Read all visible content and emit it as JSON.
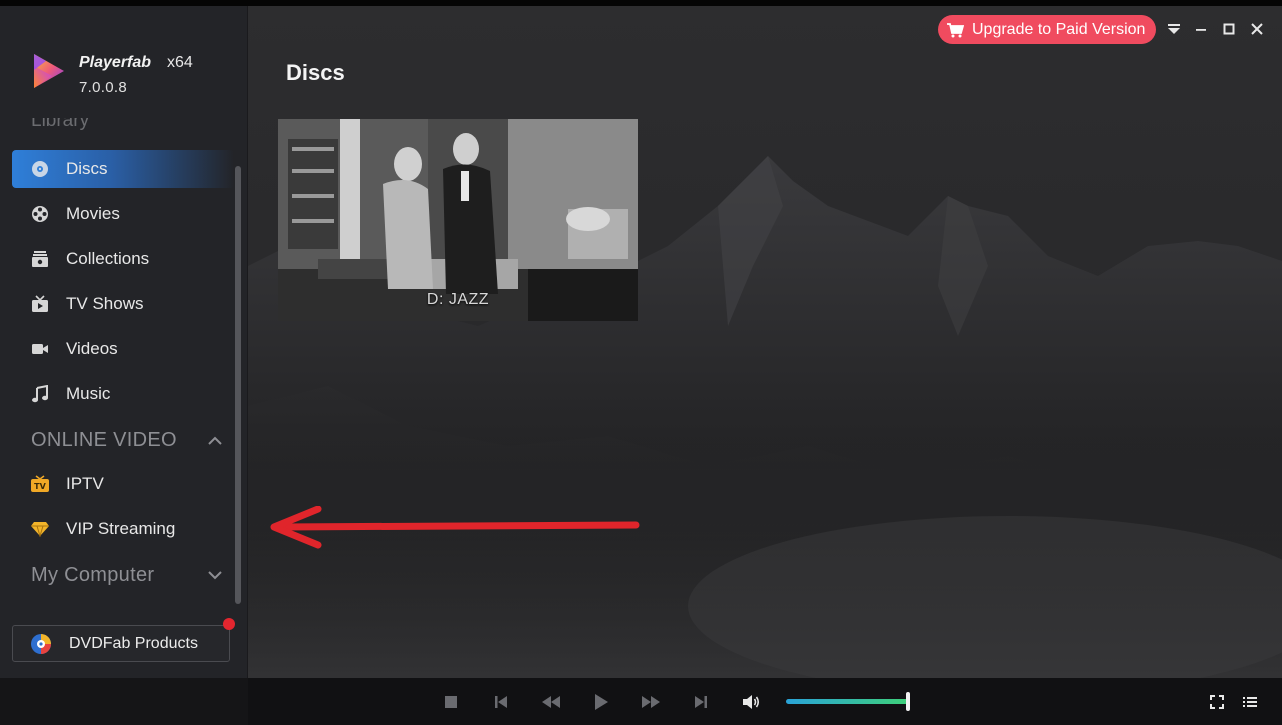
{
  "app": {
    "brand": "Playerfab",
    "arch": "x64",
    "version": "7.0.0.8"
  },
  "sidebar": {
    "library_peek": "Library",
    "items": [
      {
        "label": "Discs",
        "icon": "disc-icon",
        "active": true
      },
      {
        "label": "Movies",
        "icon": "film-reel-icon",
        "active": false
      },
      {
        "label": "Collections",
        "icon": "collections-icon",
        "active": false
      },
      {
        "label": "TV Shows",
        "icon": "tv-icon",
        "active": false
      },
      {
        "label": "Videos",
        "icon": "video-camera-icon",
        "active": false
      },
      {
        "label": "Music",
        "icon": "music-note-icon",
        "active": false
      }
    ],
    "online_section": "ONLINE VIDEO",
    "online_items": [
      {
        "label": "IPTV",
        "icon": "iptv-icon"
      },
      {
        "label": "VIP Streaming",
        "icon": "diamond-icon"
      }
    ],
    "computer_section": "My Computer",
    "products_label": "DVDFab Products"
  },
  "header": {
    "title": "Discs",
    "upgrade_label": "Upgrade to Paid Version"
  },
  "discs": [
    {
      "label": "D: JAZZ"
    }
  ],
  "player": {
    "volume_fraction": 1.0
  },
  "colors": {
    "accent": "#2f7fd9",
    "upgrade": "#f04b5f",
    "notification": "#e3262f",
    "annotation_arrow": "#e0252b"
  }
}
